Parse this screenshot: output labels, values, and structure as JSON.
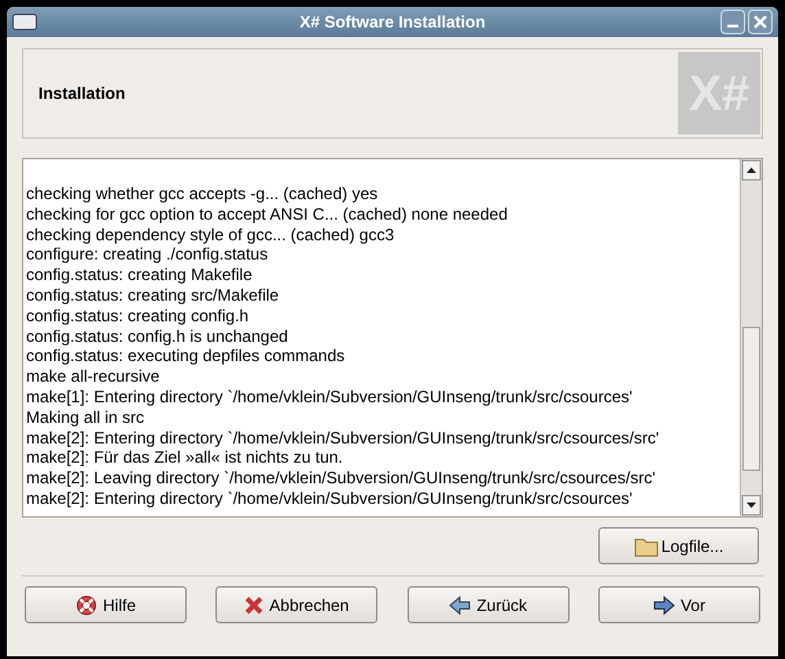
{
  "window": {
    "title": "X# Software Installation"
  },
  "header": {
    "title": "Installation",
    "logo": "X#"
  },
  "log": {
    "lines": [
      "checking whether gcc accepts -g... (cached) yes",
      "checking for gcc option to accept ANSI C... (cached) none needed",
      "checking dependency style of gcc... (cached) gcc3",
      "configure: creating ./config.status",
      "config.status: creating Makefile",
      "config.status: creating src/Makefile",
      "config.status: creating config.h",
      "config.status: config.h is unchanged",
      "config.status: executing depfiles commands",
      "make  all-recursive",
      "make[1]: Entering directory `/home/vklein/Subversion/GUInseng/trunk/src/csources'",
      "Making all in src",
      "make[2]: Entering directory `/home/vklein/Subversion/GUInseng/trunk/src/csources/src'",
      "make[2]: Für das Ziel »all« ist nichts zu tun.",
      "make[2]: Leaving directory `/home/vklein/Subversion/GUInseng/trunk/src/csources/src'",
      "make[2]: Entering directory `/home/vklein/Subversion/GUInseng/trunk/src/csources'"
    ]
  },
  "logfile_button": {
    "label": "Logfile..."
  },
  "buttons": [
    {
      "kind": "help",
      "label": "Hilfe"
    },
    {
      "kind": "cancel",
      "label": "Abbrechen"
    },
    {
      "kind": "back",
      "label": "Zurück"
    },
    {
      "kind": "forward",
      "label": "Vor"
    }
  ]
}
